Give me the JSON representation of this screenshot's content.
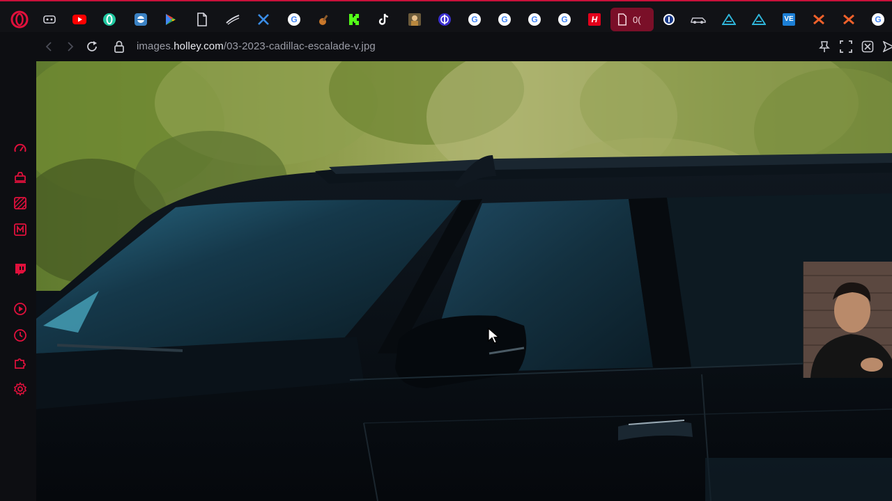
{
  "window": {
    "accent_color": "#c8103a",
    "background_color": "#0d0e12"
  },
  "tabs": [
    {
      "icon": "opera-logo-icon",
      "active": false
    },
    {
      "icon": "gamepad-icon",
      "active": false
    },
    {
      "icon": "youtube-icon",
      "active": false
    },
    {
      "icon": "opera-gx-green-icon",
      "active": false
    },
    {
      "icon": "messenger-icon",
      "active": false
    },
    {
      "icon": "google-play-icon",
      "active": false
    },
    {
      "icon": "document-icon",
      "active": false
    },
    {
      "icon": "pen-stroke-icon",
      "active": false
    },
    {
      "icon": "x-tools-icon",
      "active": false
    },
    {
      "icon": "google-icon",
      "active": false
    },
    {
      "icon": "guitar-icon",
      "active": false
    },
    {
      "icon": "kick-icon",
      "active": false
    },
    {
      "icon": "tiktok-icon",
      "active": false
    },
    {
      "icon": "character-art-icon",
      "active": false
    },
    {
      "icon": "purple-emblem-icon",
      "active": false
    },
    {
      "icon": "google-icon",
      "active": false
    },
    {
      "icon": "google-icon",
      "active": false
    },
    {
      "icon": "google-icon",
      "active": false
    },
    {
      "icon": "google-icon",
      "active": false
    },
    {
      "icon": "holley-h-icon",
      "active": false
    },
    {
      "icon": "document-icon",
      "active": true,
      "text": "0("
    },
    {
      "icon": "info-shield-icon",
      "active": false
    },
    {
      "icon": "car-outline-icon",
      "active": false
    },
    {
      "icon": "a-triangle-icon",
      "active": false
    },
    {
      "icon": "a-triangle-icon",
      "active": false
    },
    {
      "icon": "ve-icon",
      "active": false
    },
    {
      "icon": "orange-x-icon",
      "active": false
    },
    {
      "icon": "orange-x-icon",
      "active": false
    },
    {
      "icon": "google-icon",
      "active": false
    }
  ],
  "address_bar": {
    "url_prefix": "images.",
    "url_host": "holley.com",
    "url_path": "/03-2023-cadillac-escalade-v.jpg"
  },
  "sidebar": {
    "items": [
      {
        "icon": "speed-dial-icon"
      },
      {
        "icon": "gx-control-icon"
      },
      {
        "icon": "gx-corner-icon"
      },
      {
        "icon": "m-icon"
      },
      {
        "icon": "twitch-icon"
      },
      {
        "icon": "player-icon"
      },
      {
        "icon": "history-icon"
      },
      {
        "icon": "extensions-icon"
      },
      {
        "icon": "settings-icon"
      }
    ]
  },
  "content": {
    "image_subject": "Black 2023 Cadillac Escalade-V side view",
    "webcam_overlay": true
  }
}
